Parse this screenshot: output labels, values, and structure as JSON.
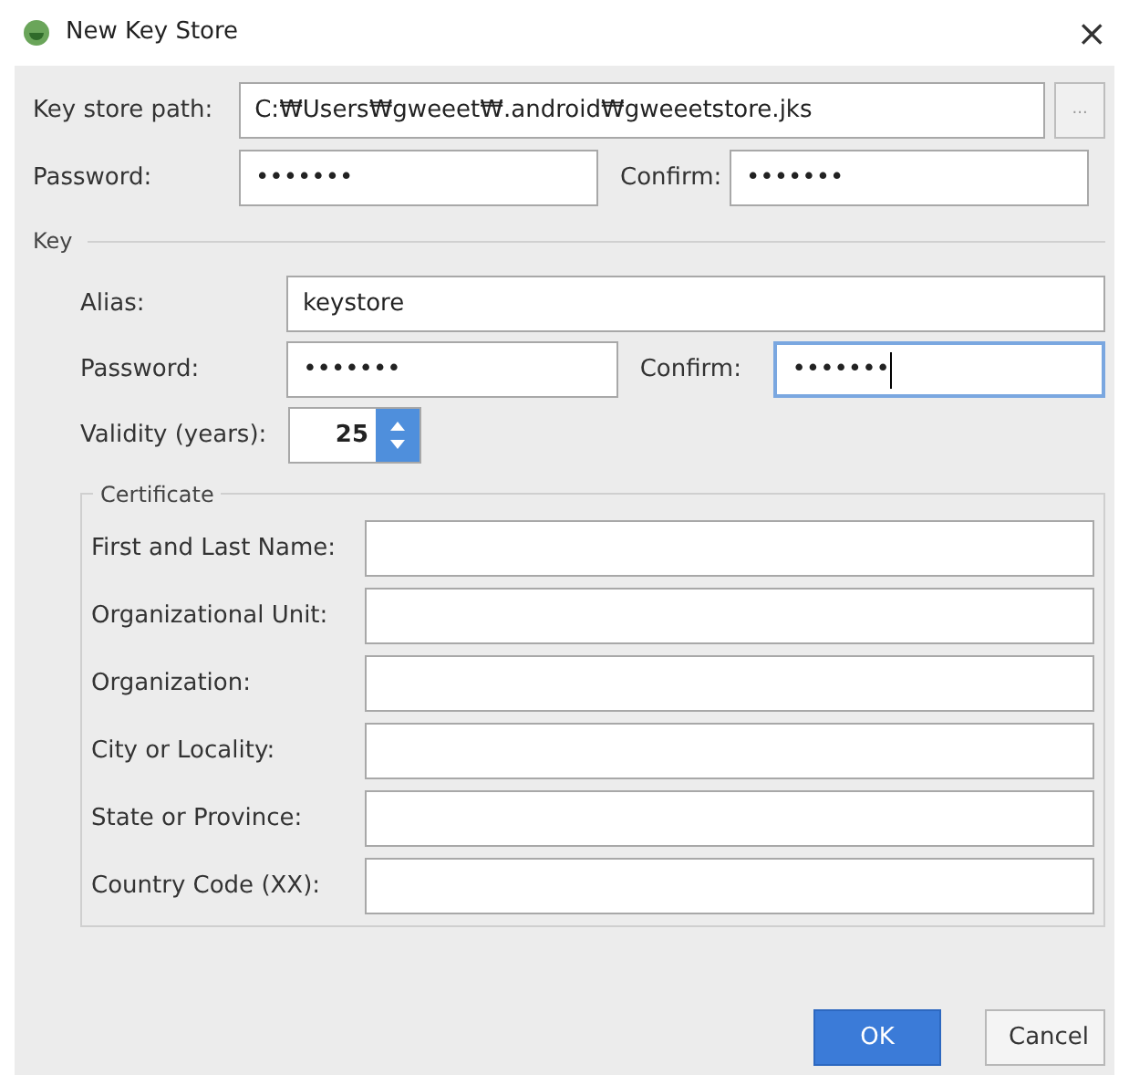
{
  "window": {
    "title": "New Key Store",
    "close": "×"
  },
  "key_store": {
    "path_label": "Key store path:",
    "path": "C:₩Users₩gweeet₩.android₩gweeetstore.jks",
    "browse": "...",
    "password_label": "Password:",
    "password": "•••••••",
    "confirm_label": "Confirm:",
    "confirm": "•••••••",
    "confirm_focused": false
  },
  "key": {
    "title": "Key",
    "alias_label": "Alias:",
    "alias": "keystore",
    "password_label": "Password:",
    "password": "•••••••",
    "confirm_label": "Confirm:",
    "confirm": "•••••••",
    "confirm_focused": true,
    "validity_label": "Validity (years):",
    "validity": "25"
  },
  "certificate": {
    "title": "Certificate",
    "fields": [
      {
        "label": "First and Last Name:"
      },
      {
        "label": "Organizational Unit:"
      },
      {
        "label": "Organization:"
      },
      {
        "label": "City or Locality:"
      },
      {
        "label": "State or Province:"
      },
      {
        "label": "Country Code (XX):"
      }
    ]
  },
  "buttons": [
    {
      "label": "OK",
      "kind": "primary"
    },
    {
      "label": "Cancel",
      "kind": "secondary"
    }
  ]
}
